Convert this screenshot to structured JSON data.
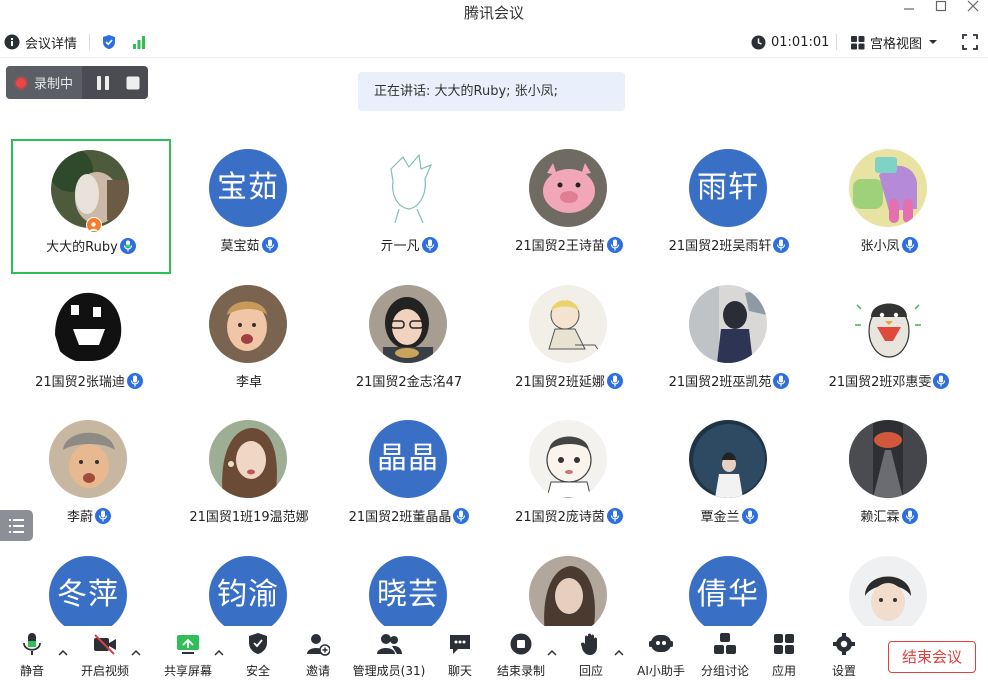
{
  "window": {
    "title": "腾讯会议"
  },
  "topbar": {
    "meeting_details": "会议详情",
    "timer": "01:01:01",
    "view_mode": "宫格视图"
  },
  "recording": {
    "label": "录制中"
  },
  "speaking": {
    "text": "正在讲话: 大大的Ruby; 张小凤;"
  },
  "participants": [
    {
      "name": "大大的Ruby",
      "avatar_text": "",
      "mic": true
    },
    {
      "name": "莫宝茹",
      "avatar_text": "宝茹",
      "mic": true
    },
    {
      "name": "亓一凡",
      "avatar_text": "",
      "mic": true
    },
    {
      "name": "21国贸2王诗苗",
      "avatar_text": "",
      "mic": true
    },
    {
      "name": "21国贸2班吴雨轩",
      "avatar_text": "雨轩",
      "mic": true
    },
    {
      "name": "张小凤",
      "avatar_text": "",
      "mic": true
    },
    {
      "name": "21国贸2张瑞迪",
      "avatar_text": "",
      "mic": true
    },
    {
      "name": "李卓",
      "avatar_text": "",
      "mic": false
    },
    {
      "name": "21国贸2金志洺47",
      "avatar_text": "",
      "mic": false
    },
    {
      "name": "21国贸2班延娜",
      "avatar_text": "",
      "mic": true
    },
    {
      "name": "21国贸2班巫凯苑",
      "avatar_text": "",
      "mic": true
    },
    {
      "name": "21国贸2班邓惠雯",
      "avatar_text": "",
      "mic": true
    },
    {
      "name": "李蔚",
      "avatar_text": "",
      "mic": true
    },
    {
      "name": "21国贸1班19温范娜",
      "avatar_text": "",
      "mic": false
    },
    {
      "name": "21国贸2班董晶晶",
      "avatar_text": "晶晶",
      "mic": true
    },
    {
      "name": "21国贸2庞诗茵",
      "avatar_text": "",
      "mic": true
    },
    {
      "name": "覃金兰",
      "avatar_text": "",
      "mic": true
    },
    {
      "name": "赖汇霖",
      "avatar_text": "",
      "mic": true
    },
    {
      "name": "",
      "avatar_text": "冬萍",
      "mic": false
    },
    {
      "name": "",
      "avatar_text": "钧渝",
      "mic": false
    },
    {
      "name": "",
      "avatar_text": "晓芸",
      "mic": false
    },
    {
      "name": "",
      "avatar_text": "",
      "mic": false
    },
    {
      "name": "",
      "avatar_text": "倩华",
      "mic": false
    },
    {
      "name": "",
      "avatar_text": "",
      "mic": false
    }
  ],
  "toolbar": {
    "mute": "静音",
    "video": "开启视频",
    "share": "共享屏幕",
    "security": "安全",
    "invite": "邀请",
    "members": "管理成员(31)",
    "chat": "聊天",
    "stop_record": "结束录制",
    "react": "回应",
    "ai": "AI小助手",
    "breakout": "分组讨论",
    "apps": "应用",
    "settings": "设置",
    "end": "结束会议"
  },
  "colors": {
    "accent": "#2d6fe0",
    "active_border": "#2fbf56",
    "avatar_blue": "#3a6fc6",
    "end_red": "#e04040"
  }
}
